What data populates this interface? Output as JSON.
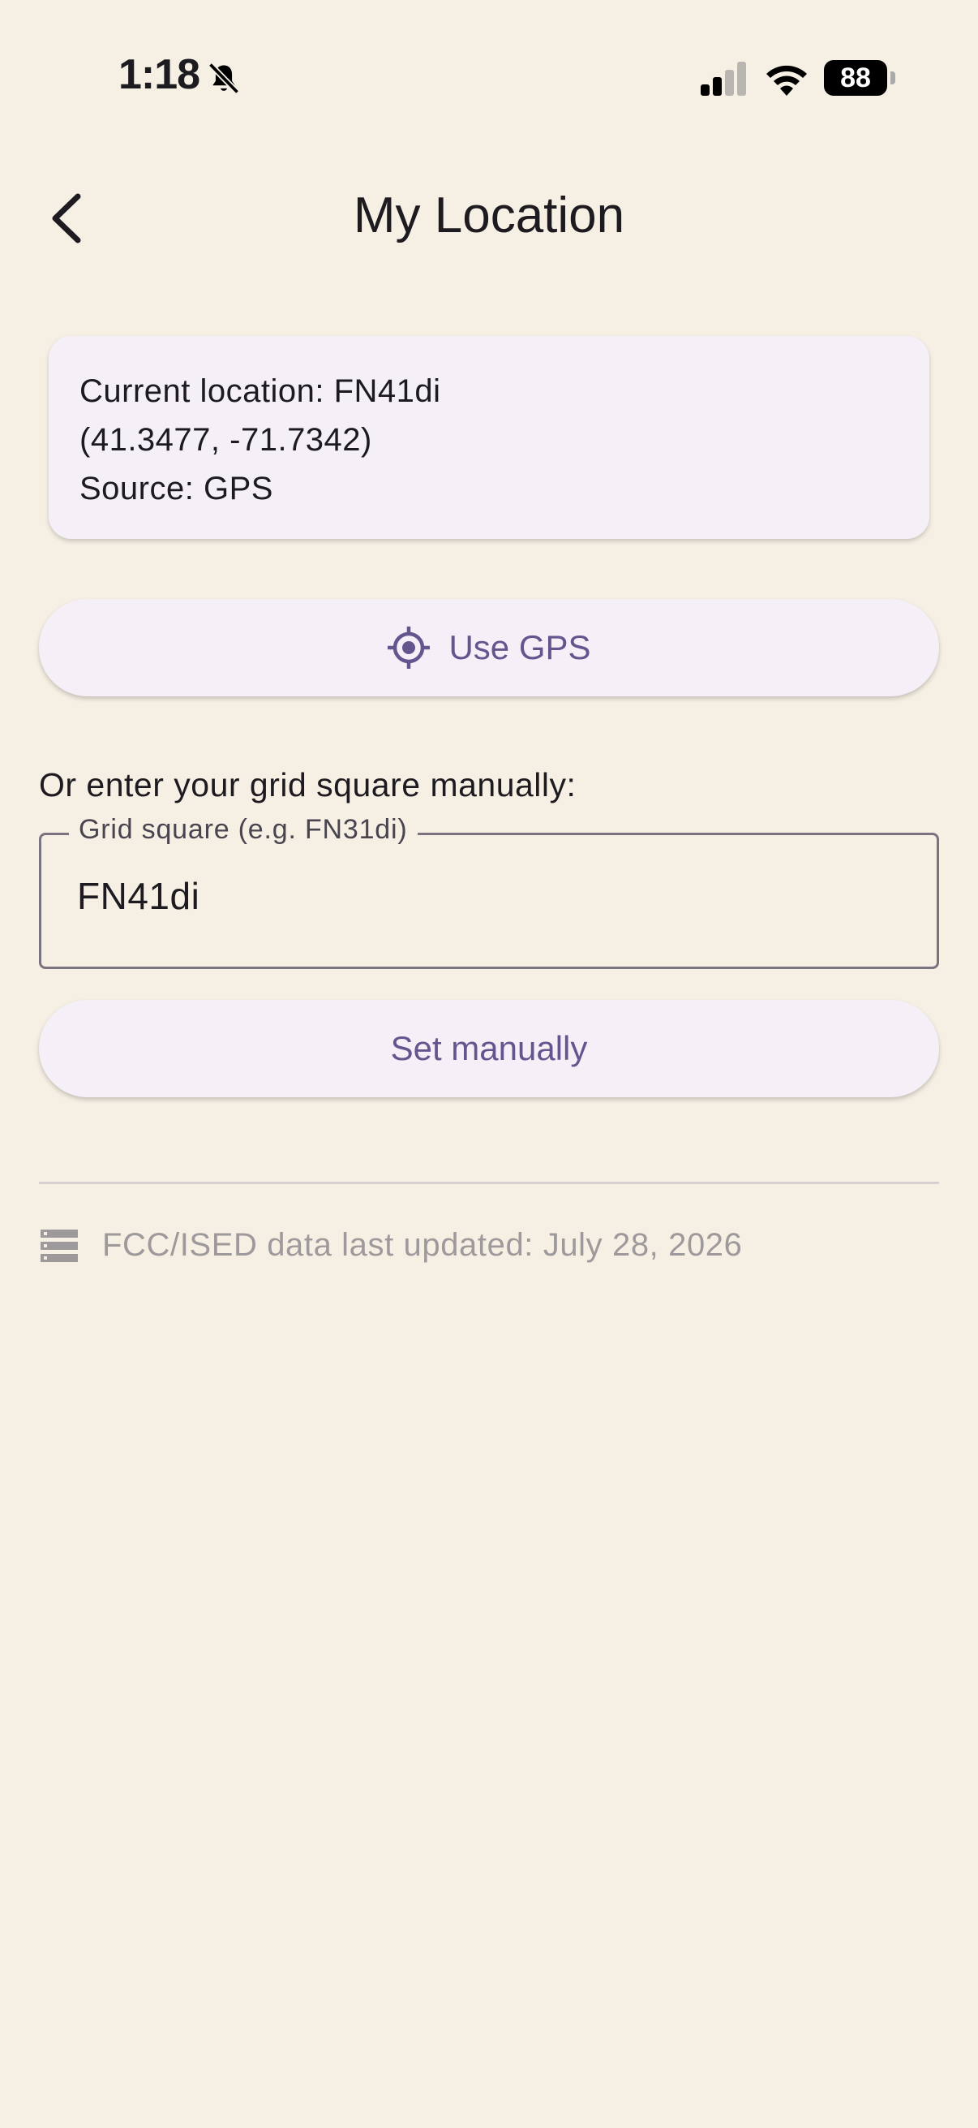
{
  "status_bar": {
    "time": "1:18",
    "battery": "88",
    "icons": [
      "bell-slash-icon",
      "cellular-signal-icon",
      "wifi-icon",
      "battery-icon"
    ]
  },
  "app_bar": {
    "title": "My Location",
    "back_icon": "chevron-left-icon"
  },
  "location_card": {
    "line1": "Current location: FN41di",
    "line2": "(41.3477, -71.7342)",
    "line3": "Source: GPS"
  },
  "gps_button": {
    "label": "Use GPS",
    "icon": "gps-crosshair-icon"
  },
  "manual": {
    "prompt": "Or enter your grid square manually:",
    "field_label": "Grid square (e.g. FN31di)",
    "field_value": "FN41di",
    "set_label": "Set manually"
  },
  "footer": {
    "icon": "storage-icon",
    "text": "FCC/ISED data last updated: July 28, 2026"
  },
  "colors": {
    "background": "#f6f0e4",
    "card": "#f5f0f7",
    "accent": "#65558f",
    "muted_text": "#9e9a9c"
  }
}
